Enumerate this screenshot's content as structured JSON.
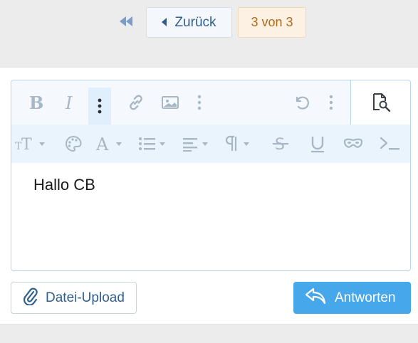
{
  "pagination": {
    "prev_label": "Zurück",
    "page_info": "3 von 3"
  },
  "editor": {
    "content": "Hallo CB"
  },
  "actions": {
    "upload_label": "Datei-Upload",
    "reply_label": "Antworten"
  },
  "icons": {
    "first_page": "double-chevron-left-icon",
    "prev": "caret-left-icon",
    "bold": "bold-icon",
    "italic": "italic-icon",
    "more": "more-vertical-icon",
    "link": "link-icon",
    "image": "image-icon",
    "undo": "undo-icon",
    "preview": "preview-icon",
    "font_size": "font-size-icon",
    "color": "palette-icon",
    "font": "font-icon",
    "list": "list-icon",
    "align": "align-icon",
    "paragraph": "paragraph-icon",
    "strike": "strikethrough-icon",
    "underline": "underline-icon",
    "spoiler": "mask-icon",
    "code": "code-icon",
    "paperclip": "paperclip-icon",
    "reply": "reply-icon"
  },
  "colors": {
    "accent": "#47a7eb",
    "link": "#2f5f8f",
    "page_badge_bg": "#fdf1e3",
    "page_badge_text": "#b06a1c",
    "toolbar_icon": "#a9b6c3"
  }
}
